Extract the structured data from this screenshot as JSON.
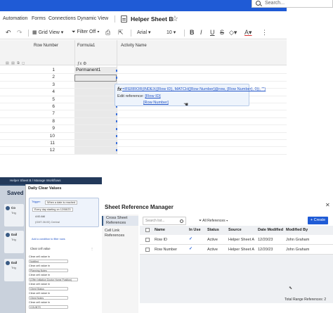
{
  "search": {
    "placeholder": "Search..."
  },
  "menu": [
    "Automation",
    "Forms",
    "Connections",
    "Dynamic View"
  ],
  "sheet": {
    "title": "Helper Sheet B"
  },
  "toolbar": {
    "grid_view": "Grid View",
    "filter": "Filter Off",
    "font": "Arial",
    "size": "10"
  },
  "columns": [
    "Row Number",
    "Formula1",
    "Activity Name"
  ],
  "rows": [
    "1",
    "2",
    "3",
    "4",
    "5",
    "6",
    "7",
    "8",
    "9",
    "10",
    "11",
    "12"
  ],
  "cell_value": "Permanent1",
  "popup": {
    "fx": "fx",
    "formula": "=IFERROR(INDEX({Row ID}, MATCH([Row Number]@row, {Row Number}, 0)), \"\")",
    "edit_label": "Edit reference:",
    "ref1": "[Row ID]",
    "ref2": "[Row Number]"
  },
  "left_panel": {
    "breadcrumb": "Helper Sheet B  /  Manage Workflows",
    "saved": "Saved",
    "cards": [
      {
        "title": "Co",
        "sub": "Trig"
      },
      {
        "title": "Dail",
        "sub": "Trig"
      },
      {
        "title": "Dail",
        "sub": "Trig"
      }
    ],
    "dialog_title": "Daily Clear Values",
    "trigger_label": "Trigger:",
    "trigger_value": "When a date is reached",
    "every_day": "Every day starting on 12/08/23",
    "time_value": "4:00 AM",
    "timezone": "(GMT-06:00) Central",
    "add_condition": "Add a condition to filter rows",
    "clear_cell": "Clear cell value",
    "fields": [
      {
        "label": "Clear cell value in",
        "value": "Notified"
      },
      {
        "label": "Clear cell value in",
        "value": "Planning Notes"
      },
      {
        "label": "Clear cell value in",
        "value": "(Offer Initiation Doctor Home Position)"
      },
      {
        "label": "Clear cell value in",
        "value": "Client Status"
      },
      {
        "label": "Clear cell value in",
        "value": "Client Notes"
      },
      {
        "label": "Clear cell value in",
        "value": "COUNTS"
      }
    ]
  },
  "manager": {
    "title": "Sheet Reference Manager",
    "tabs": [
      "Cross Sheet References",
      "Cell Link References"
    ],
    "search_placeholder": "Search list...",
    "filter": "All References",
    "create": "+ Create",
    "headers": [
      "Name",
      "In Use",
      "Status",
      "Source",
      "Date Modified",
      "Modified By"
    ],
    "rows": [
      {
        "name": "Row ID",
        "status": "Active",
        "source": "Helper Sheet A",
        "date": "12/20/23",
        "by": "John Graham"
      },
      {
        "name": "Row Number",
        "status": "Active",
        "source": "Helper Sheet A",
        "date": "12/20/23",
        "by": "John Graham"
      }
    ],
    "total": "Total Range References: 2"
  }
}
